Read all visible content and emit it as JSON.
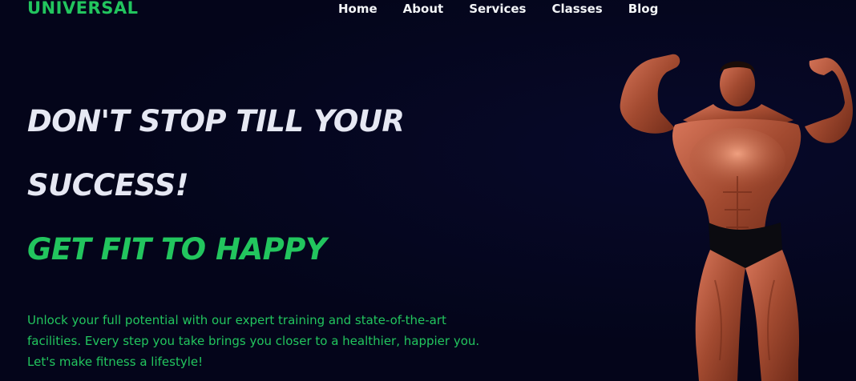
{
  "brand": {
    "logo": "UNIVERSAL"
  },
  "nav": {
    "items": [
      {
        "label": "Home"
      },
      {
        "label": "About"
      },
      {
        "label": "Services"
      },
      {
        "label": "Classes"
      },
      {
        "label": "Blog"
      }
    ]
  },
  "hero": {
    "headline_line1": "DON'T STOP TILL YOUR",
    "headline_line2": "SUCCESS!",
    "tagline": "GET FIT TO HAPPY",
    "description": "Unlock your full potential with our expert training and state-of-the-art facilities. Every step you take brings you closer to a healthier, happier you. Let's make fitness a lifestyle!"
  },
  "colors": {
    "background": "#04051a",
    "accent": "#22c55e",
    "headline": "#e6e8f3",
    "nav_text": "#f2f4f7"
  }
}
